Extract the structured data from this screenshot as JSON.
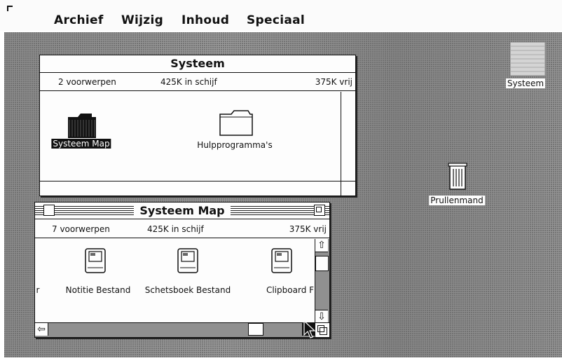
{
  "menubar": {
    "apple_glyph": "",
    "menus": [
      "Archief",
      "Wijzig",
      "Inhoud",
      "Speciaal"
    ]
  },
  "window_systeem": {
    "title": "Systeem",
    "item_count": "2 voorwerpen",
    "disk_used": "425K in schijf",
    "disk_free": "375K vrij",
    "items": [
      {
        "label": "Systeem Map",
        "icon": "folder-filled-icon",
        "selected": true
      },
      {
        "label": "Hulpprogramma's",
        "icon": "folder-icon",
        "selected": false
      }
    ]
  },
  "window_systeem_map": {
    "title": "Systeem Map",
    "item_count": "7 voorwerpen",
    "disk_used": "425K in schijf",
    "disk_free": "375K vrij",
    "items": [
      {
        "label": "r",
        "icon": "document-partial"
      },
      {
        "label": "Notitie Bestand",
        "icon": "mac-document-icon"
      },
      {
        "label": "Schetsboek Bestand",
        "icon": "mac-document-icon"
      },
      {
        "label": "Clipboard Fi",
        "icon": "mac-document-icon"
      }
    ]
  },
  "desktop_icons": [
    {
      "label": "Systeem",
      "icon": "disk-icon"
    },
    {
      "label": "Prullenmand",
      "icon": "trash-icon"
    }
  ]
}
